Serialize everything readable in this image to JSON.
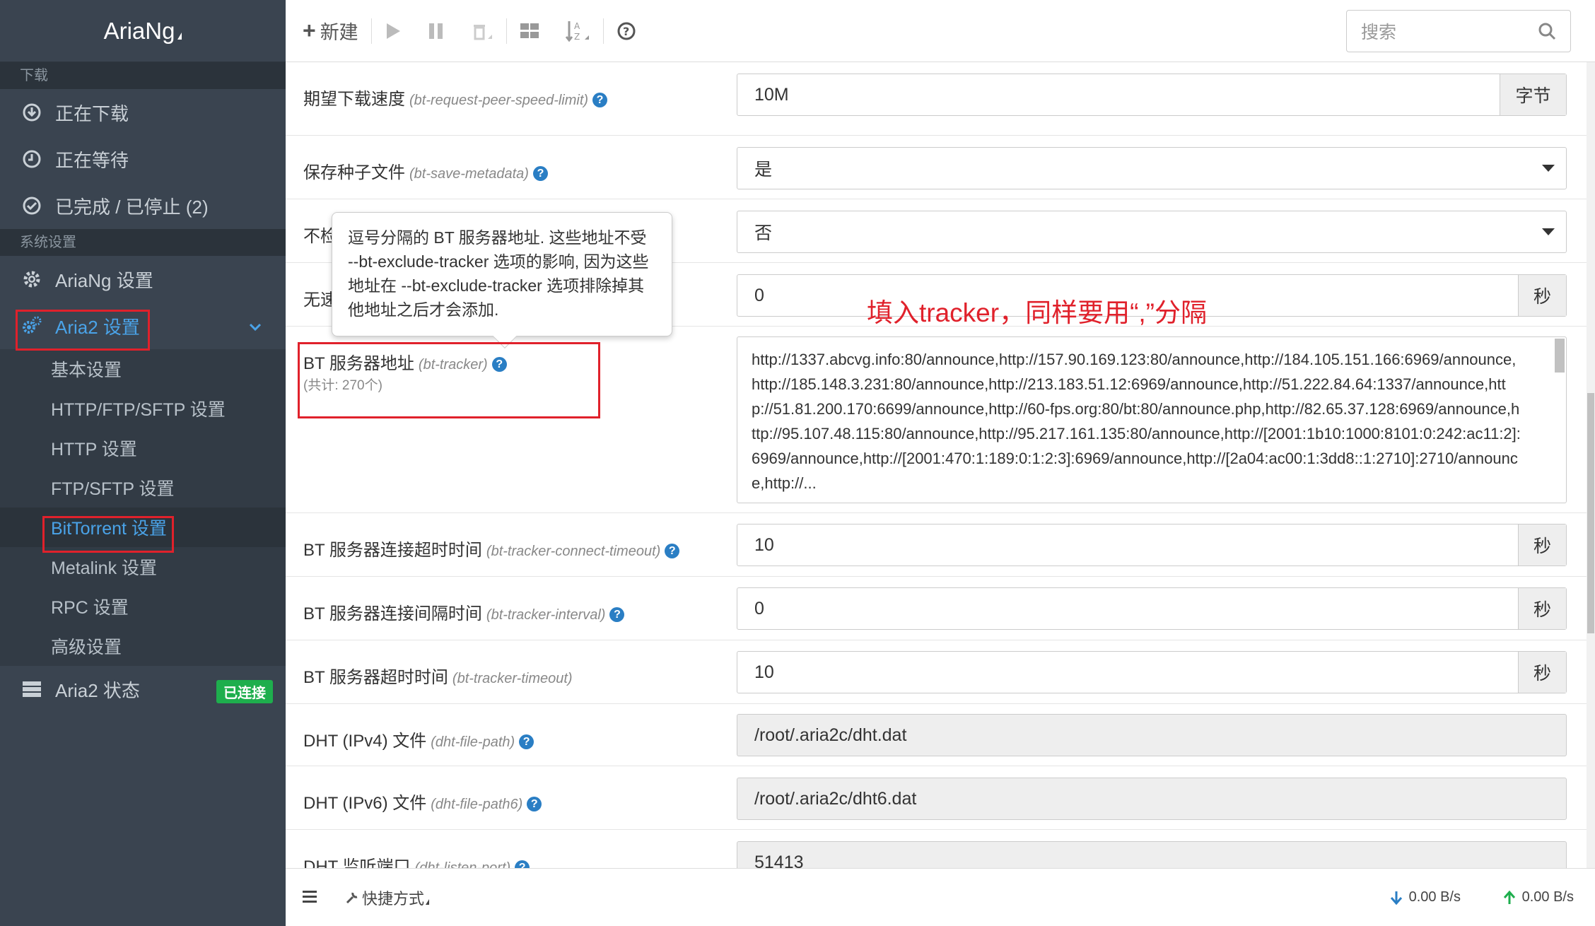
{
  "app": {
    "brand": "AriaNg"
  },
  "sidebar": {
    "download_header": "下载",
    "downloading": "正在下载",
    "waiting": "正在等待",
    "stopped": "已完成 / 已停止 (2)",
    "system_header": "系统设置",
    "ariang_settings": "AriaNg 设置",
    "aria2_settings": "Aria2 设置",
    "sub_items": [
      "基本设置",
      "HTTP/FTP/SFTP 设置",
      "HTTP 设置",
      "FTP/SFTP 设置",
      "BitTorrent 设置",
      "Metalink 设置",
      "RPC 设置",
      "高级设置"
    ],
    "aria2_status": "Aria2 状态",
    "status_badge": "已连接"
  },
  "toolbar": {
    "new_label": "新建",
    "search_placeholder": "搜索"
  },
  "settings": [
    {
      "label": "期望下载速度",
      "key": "(bt-request-peer-speed-limit)",
      "value": "10M",
      "unit": "字节"
    },
    {
      "label": "保存种子文件",
      "key": "(bt-save-metadata)",
      "value": "是"
    },
    {
      "label": "不检",
      "value": "否"
    },
    {
      "label": "无速",
      "value": "0",
      "unit": "秒"
    },
    {
      "label": "BT 服务器地址",
      "key": "(bt-tracker)",
      "count": "(共计: 270个)",
      "value": "http://1337.abcvg.info:80/announce,http://157.90.169.123:80/announce,http://184.105.151.166:6969/announce,http://185.148.3.231:80/announce,http://213.183.51.12:6969/announce,http://51.222.84.64:1337/announce,http://51.81.200.170:6699/announce,http://60-fps.org:80/bt:80/announce.php,http://82.65.37.128:6969/announce,http://95.107.48.115:80/announce,http://95.217.161.135:80/announce,http://[2001:1b10:1000:8101:0:242:ac11:2]:6969/announce,http://[2001:470:1:189:0:1:2:3]:6969/announce,http://[2a04:ac00:1:3dd8::1:2710]:2710/announce,http://..."
    },
    {
      "label": "BT 服务器连接超时时间",
      "key": "(bt-tracker-connect-timeout)",
      "value": "10",
      "unit": "秒"
    },
    {
      "label": "BT 服务器连接间隔时间",
      "key": "(bt-tracker-interval)",
      "value": "0",
      "unit": "秒"
    },
    {
      "label": "BT 服务器超时时间",
      "key": "(bt-tracker-timeout)",
      "value": "10",
      "unit": "秒"
    },
    {
      "label": "DHT (IPv4) 文件",
      "key": "(dht-file-path)",
      "value": "/root/.aria2c/dht.dat"
    },
    {
      "label": "DHT (IPv6) 文件",
      "key": "(dht-file-path6)",
      "value": "/root/.aria2c/dht6.dat"
    },
    {
      "label": "DHT 监听端口",
      "key": "(dht-listen-port)",
      "value": "51413"
    }
  ],
  "tooltip": {
    "text": "逗号分隔的 BT 服务器地址. 这些地址不受 --bt-exclude-tracker 选项的影响, 因为这些地址在 --bt-exclude-tracker 选项排除掉其他地址之后才会添加."
  },
  "annotation": {
    "text": "填入tracker，同样要用“,”分隔"
  },
  "footer": {
    "shortcut": "快捷方式",
    "download_speed": "0.00 B/s",
    "upload_speed": "0.00 B/s"
  },
  "colors": {
    "accent": "#4aa3e8",
    "sidebar_bg": "#3a4450",
    "connected": "#1eae4d",
    "annotation": "#e0212b"
  }
}
